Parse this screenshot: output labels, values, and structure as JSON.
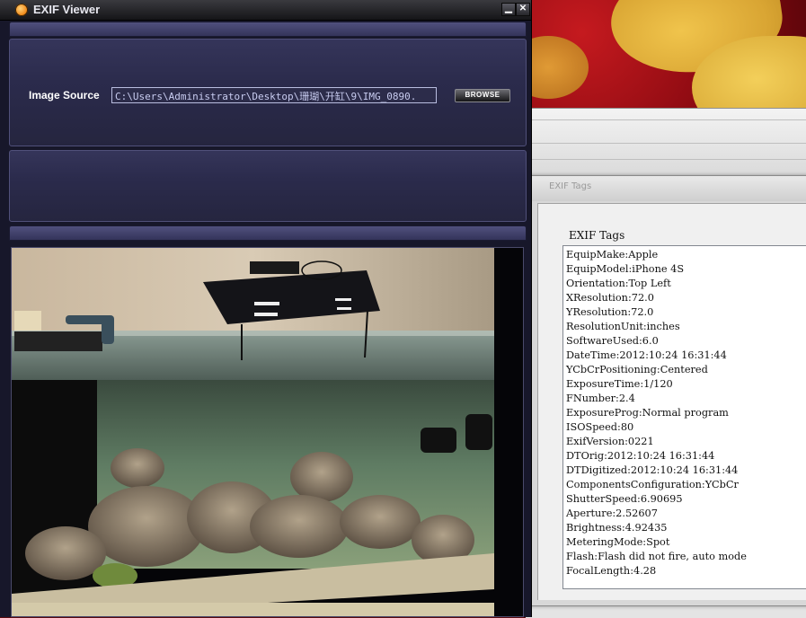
{
  "viewer": {
    "title": "EXIF Viewer",
    "min_glyph": "▁",
    "close_glyph": "✕",
    "image_source_label": "Image Source",
    "image_source_value": "C:\\Users\\Administrator\\Desktop\\珊瑚\\开缸\\9\\IMG_0890.",
    "browse_label": "BROWSE"
  },
  "tags_window": {
    "title": "EXIF Tags",
    "section_label": "EXIF Tags",
    "tags": [
      "EquipMake:Apple",
      "EquipModel:iPhone 4S",
      "Orientation:Top Left",
      "XResolution:72.0",
      "YResolution:72.0",
      "ResolutionUnit:inches",
      "SoftwareUsed:6.0",
      "DateTime:2012:10:24 16:31:44",
      "YCbCrPositioning:Centered",
      "ExposureTime:1/120",
      "FNumber:2.4",
      "ExposureProg:Normal program",
      "ISOSpeed:80",
      "ExifVersion:0221",
      "DTOrig:2012:10:24 16:31:44",
      "DTDigitized:2012:10:24 16:31:44",
      "ComponentsConfiguration:YCbCr",
      "ShutterSpeed:6.90695",
      "Aperture:2.52607",
      "Brightness:4.92435",
      "MeteringMode:Spot",
      "Flash:Flash did not fire, auto mode",
      "FocalLength:4.28"
    ]
  },
  "background": {
    "hint_char": "9"
  }
}
